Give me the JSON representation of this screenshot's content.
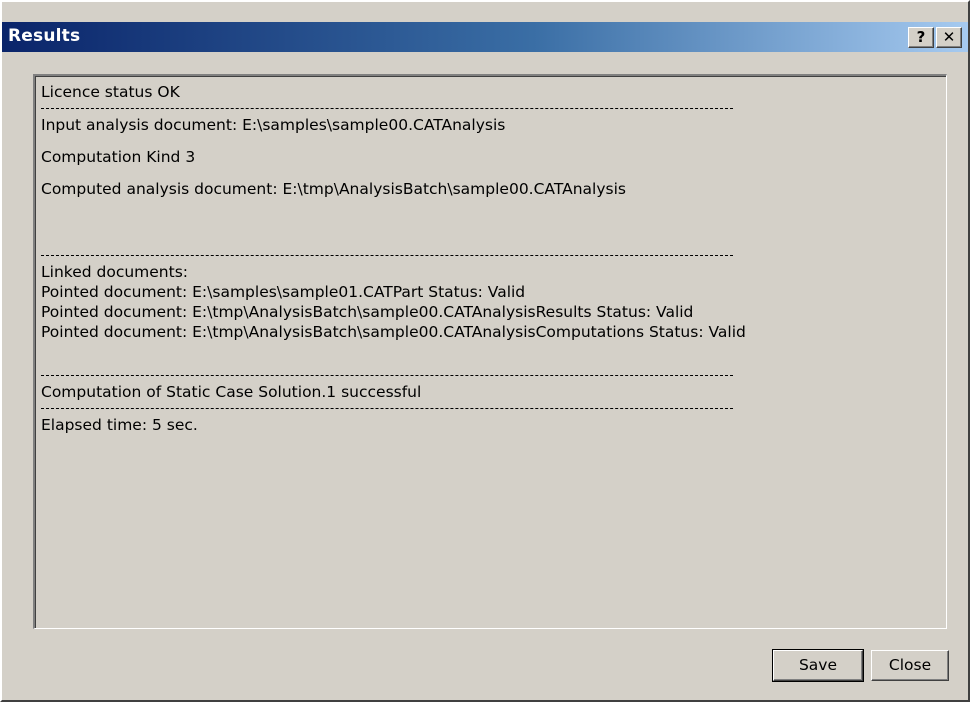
{
  "window": {
    "title": "Results",
    "help_label": "?",
    "close_label": "✕"
  },
  "log": {
    "license_status": "Licence status OK",
    "input_doc": "Input analysis document: E:\\samples\\sample00.CATAnalysis",
    "computation_kind": "Computation Kind 3",
    "computed_doc": "Computed analysis document: E:\\tmp\\AnalysisBatch\\sample00.CATAnalysis",
    "linked_header": "Linked documents:",
    "pointed_docs": [
      "Pointed document: E:\\samples\\sample01.CATPart Status: Valid",
      "Pointed document: E:\\tmp\\AnalysisBatch\\sample00.CATAnalysisResults Status: Valid",
      "Pointed document: E:\\tmp\\AnalysisBatch\\sample00.CATAnalysisComputations Status: Valid"
    ],
    "computation_result": "Computation of Static Case Solution.1 successful",
    "elapsed": "Elapsed time: 5 sec."
  },
  "buttons": {
    "save": "Save",
    "close": "Close"
  }
}
